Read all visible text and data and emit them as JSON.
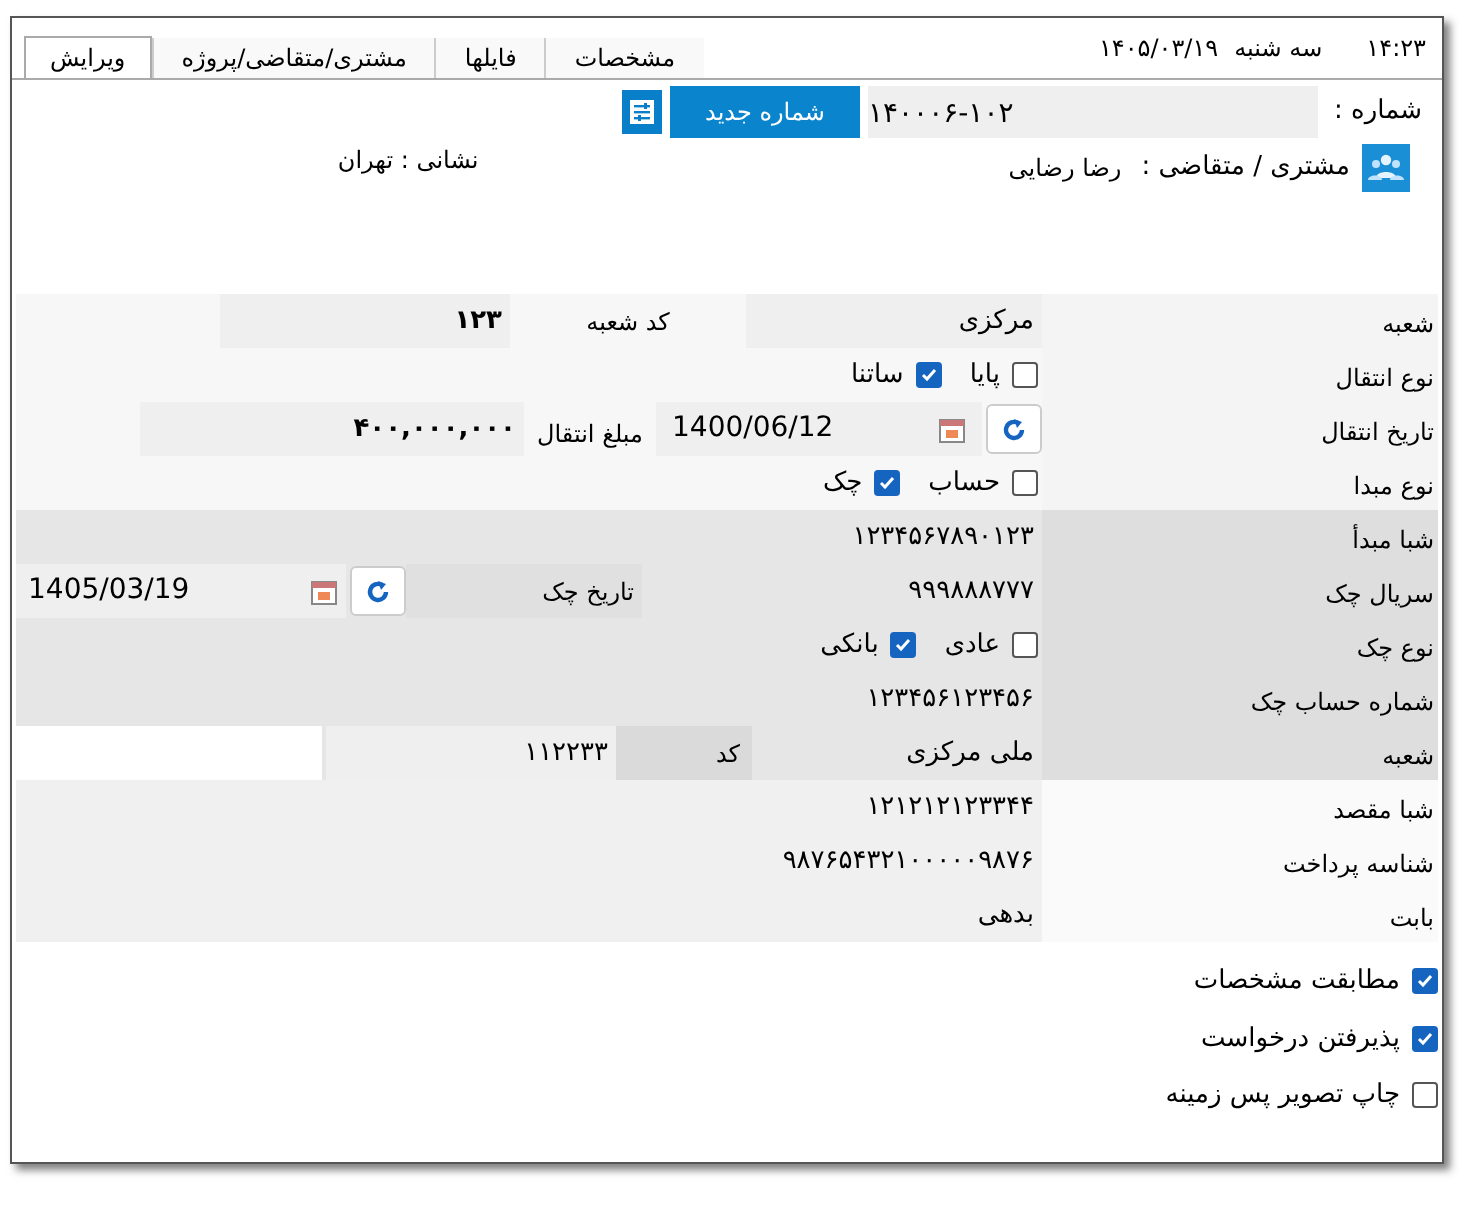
{
  "header": {
    "time": "۱۴:۲۳",
    "day": "سه شنبه",
    "date": "۱۴۰۵/۰۳/۱۹"
  },
  "tabs": [
    {
      "label": "مشخصات",
      "selected": false
    },
    {
      "label": "فایلها",
      "selected": false
    },
    {
      "label": "مشتری/متقاضی/پروژه",
      "selected": false
    },
    {
      "label": "ویرایش",
      "selected": true
    }
  ],
  "number": {
    "label": "شماره :",
    "value": "۱۴۰۰۰۶-۱۰۲",
    "button": "شماره جدید"
  },
  "customer": {
    "label": "مشتری / متقاضی :",
    "name": "رضا رضایی",
    "address": "نشانی : تهران"
  },
  "sections": [
    [
      {
        "kind": "pair",
        "label": "شعبه",
        "value": "مرکزی",
        "sub_label": "کد شعبه",
        "sub_value": "۱۲۳"
      },
      {
        "kind": "checks",
        "label": "نوع انتقال",
        "options": [
          {
            "label": "پایا",
            "checked": false
          },
          {
            "label": "ساتنا",
            "checked": true
          }
        ]
      },
      {
        "kind": "date_amount",
        "label": "تاریخ انتقال",
        "date": "1400/06/12",
        "sub_label": "مبلغ انتقال",
        "sub_value": "۴۰۰,۰۰۰,۰۰۰"
      },
      {
        "kind": "checks",
        "label": "نوع مبدا",
        "options": [
          {
            "label": "حساب",
            "checked": false
          },
          {
            "label": "چک",
            "checked": true
          }
        ]
      }
    ],
    [
      {
        "kind": "text",
        "label": "شبا مبدأ",
        "value": "۱۲۳۴۵۶۷۸۹۰۱۲۳"
      },
      {
        "kind": "serial_date",
        "label": "سریال چک",
        "value": "۹۹۹۸۸۸۷۷۷",
        "sub_label": "تاریخ چک",
        "date": "1405/03/19"
      },
      {
        "kind": "checks",
        "label": "نوع چک",
        "options": [
          {
            "label": "عادی",
            "checked": false
          },
          {
            "label": "بانکی",
            "checked": true
          }
        ]
      },
      {
        "kind": "text",
        "label": "شماره حساب چک",
        "value": "۱۲۳۴۵۶۱۲۳۴۵۶"
      },
      {
        "kind": "branch_code",
        "label": "شعبه",
        "value": "ملی مرکزی",
        "sub_label": "کد",
        "sub_value": "۱۱۲۲۳۳"
      }
    ],
    [
      {
        "kind": "text",
        "label": "شبا مقصد",
        "value": "۱۲۱۲۱۲۱۲۳۳۴۴"
      },
      {
        "kind": "text",
        "label": "شناسه پرداخت",
        "value": "۹۸۷۶۵۴۳۲۱۰۰۰۰۰۹۸۷۶"
      },
      {
        "kind": "text",
        "label": "بابت",
        "value": "بدهی"
      }
    ]
  ],
  "options": [
    {
      "label": "مطابقت مشخصات",
      "checked": true
    },
    {
      "label": "پذیرفتن درخواست",
      "checked": true
    },
    {
      "label": "چاپ تصویر پس زمینه",
      "checked": false
    }
  ]
}
